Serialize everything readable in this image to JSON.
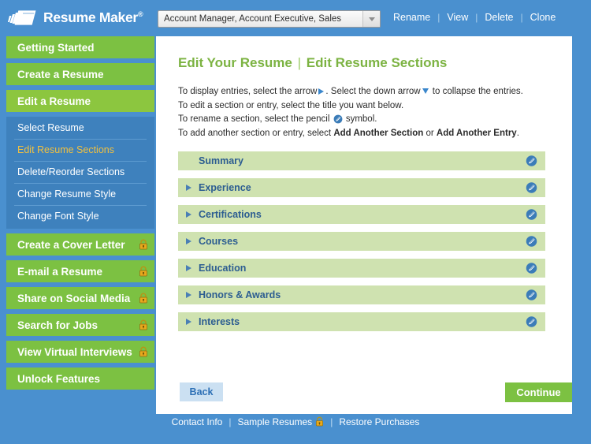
{
  "app": {
    "brand": "Resume Maker",
    "brand_mark": "pages-stack-icon",
    "trademark": "®"
  },
  "topbar": {
    "resume_select": {
      "value": "Account Manager, Account Executive, Sales",
      "arrow_icon": "chevron-down-icon"
    },
    "actions": [
      {
        "label": "Rename"
      },
      {
        "label": "View"
      },
      {
        "label": "Delete"
      },
      {
        "label": "Clone"
      }
    ],
    "separator": "|"
  },
  "sidebar": {
    "items": [
      {
        "label": "Getting Started",
        "locked": false,
        "active": false
      },
      {
        "label": "Create a Resume",
        "locked": false,
        "active": false
      },
      {
        "label": "Edit a Resume",
        "locked": false,
        "active": true
      }
    ],
    "subitems": [
      {
        "label": "Select Resume",
        "current": false
      },
      {
        "label": "Edit Resume Sections",
        "current": true
      },
      {
        "label": "Delete/Reorder Sections",
        "current": false
      },
      {
        "label": "Change Resume Style",
        "current": false
      },
      {
        "label": "Change Font Style",
        "current": false
      }
    ],
    "items_locked": [
      {
        "label": "Create a Cover Letter",
        "locked": true
      },
      {
        "label": "E-mail a Resume",
        "locked": true
      },
      {
        "label": "Share on Social Media",
        "locked": true
      },
      {
        "label": "Search for Jobs",
        "locked": true
      },
      {
        "label": "View Virtual Interviews",
        "locked": true
      },
      {
        "label": "Unlock Features",
        "locked": false
      }
    ],
    "lock_icon": "padlock-icon"
  },
  "main": {
    "title_part1": "Edit Your Resume",
    "title_separator": "|",
    "title_part2": "Edit Resume Sections",
    "instructions": {
      "line1_a": "To display entries, select the arrow",
      "line1_b": ". Select the down arrow",
      "line1_c": "to collapse the entries.",
      "line2": "To edit a section or entry, select the title you want below.",
      "line3_a": "To rename a section, select the pencil",
      "line3_b": "symbol.",
      "line4_a": "To add another section or entry, select",
      "line4_b": "Add Another Section",
      "line4_c": "or",
      "line4_d": "Add Another Entry",
      "line4_e": "."
    },
    "sections": [
      {
        "label": "Summary",
        "has_arrow": false
      },
      {
        "label": "Experience",
        "has_arrow": true
      },
      {
        "label": "Certifications",
        "has_arrow": true
      },
      {
        "label": "Courses",
        "has_arrow": true
      },
      {
        "label": "Education",
        "has_arrow": true
      },
      {
        "label": "Honors & Awards",
        "has_arrow": true
      },
      {
        "label": "Interests",
        "has_arrow": true
      }
    ],
    "pencil_icon": "pencil-edit-icon",
    "back_label": "Back",
    "continue_label": "Continue"
  },
  "footer": {
    "links": [
      {
        "label": "Contact Info",
        "locked": false
      },
      {
        "label": "Sample Resumes",
        "locked": true
      },
      {
        "label": "Restore Purchases",
        "locked": false
      }
    ],
    "separator": "|",
    "lock_icon": "padlock-icon"
  },
  "colors": {
    "blue_bg": "#4a90cf",
    "green": "#7cc142",
    "sub_blue": "#3e81bd",
    "row_green": "#cfe2b0",
    "row_text": "#2c5d91",
    "gold": "#f0c040",
    "white": "#ffffff"
  }
}
